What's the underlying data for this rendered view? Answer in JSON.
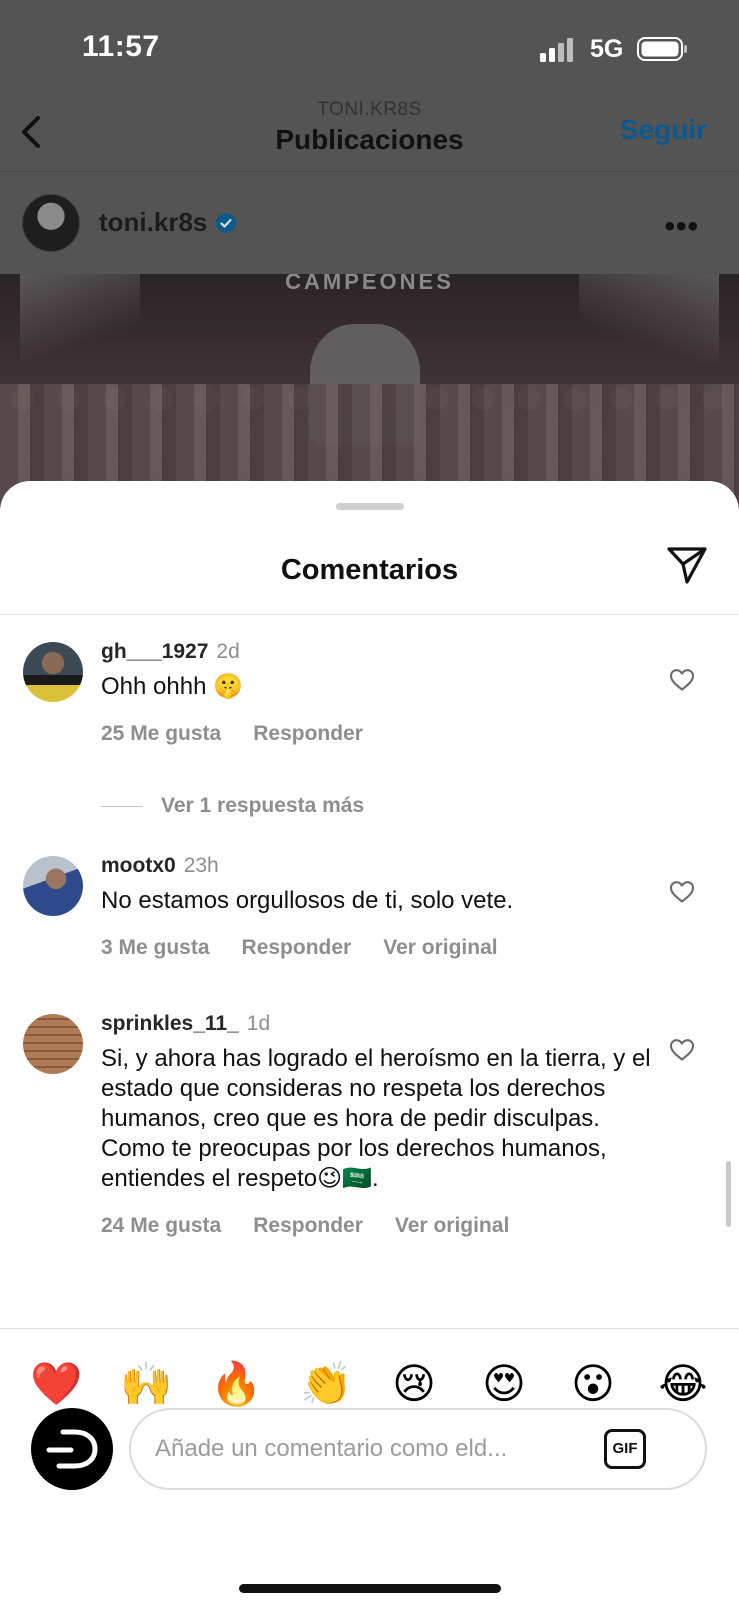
{
  "status_bar": {
    "time": "11:57",
    "network": "5G"
  },
  "nav": {
    "subtitle": "TONI.KR8S",
    "title": "Publicaciones",
    "follow_label": "Seguir"
  },
  "post": {
    "author": "toni.kr8s",
    "image_text": "CAMPEONES"
  },
  "sheet": {
    "title": "Comentarios"
  },
  "comments": [
    {
      "username": "gh___1927",
      "time": "2d",
      "text": "Ohh ohhh 🤫",
      "likes": "25 Me gusta",
      "reply": "Responder"
    },
    {
      "username": "mootx0",
      "time": "23h",
      "text": "No estamos orgullosos de ti, solo vete.",
      "likes": "3 Me gusta",
      "reply": "Responder",
      "original": "Ver original"
    },
    {
      "username": "sprinkles_11_",
      "time": "1d",
      "text": "Si, y ahora has logrado el heroísmo en la tierra, y el estado que consideras no respeta los derechos humanos, creo que es hora de pedir disculpas. Como te preocupas por los derechos humanos, entiendes el respeto😉🇸🇦.",
      "likes": "24 Me gusta",
      "reply": "Responder",
      "original": "Ver original"
    }
  ],
  "more_replies": "Ver 1 respuesta más",
  "emoji_bar": [
    "❤️",
    "🙌",
    "🔥",
    "👏",
    "😢",
    "😍",
    "😮",
    "😂"
  ],
  "input": {
    "placeholder": "Añade un comentario como eld...",
    "gif_label": "GIF"
  },
  "colors": {
    "follow": "#0095f6",
    "verified": "#0095f6",
    "muted": "#8e8e8e"
  }
}
